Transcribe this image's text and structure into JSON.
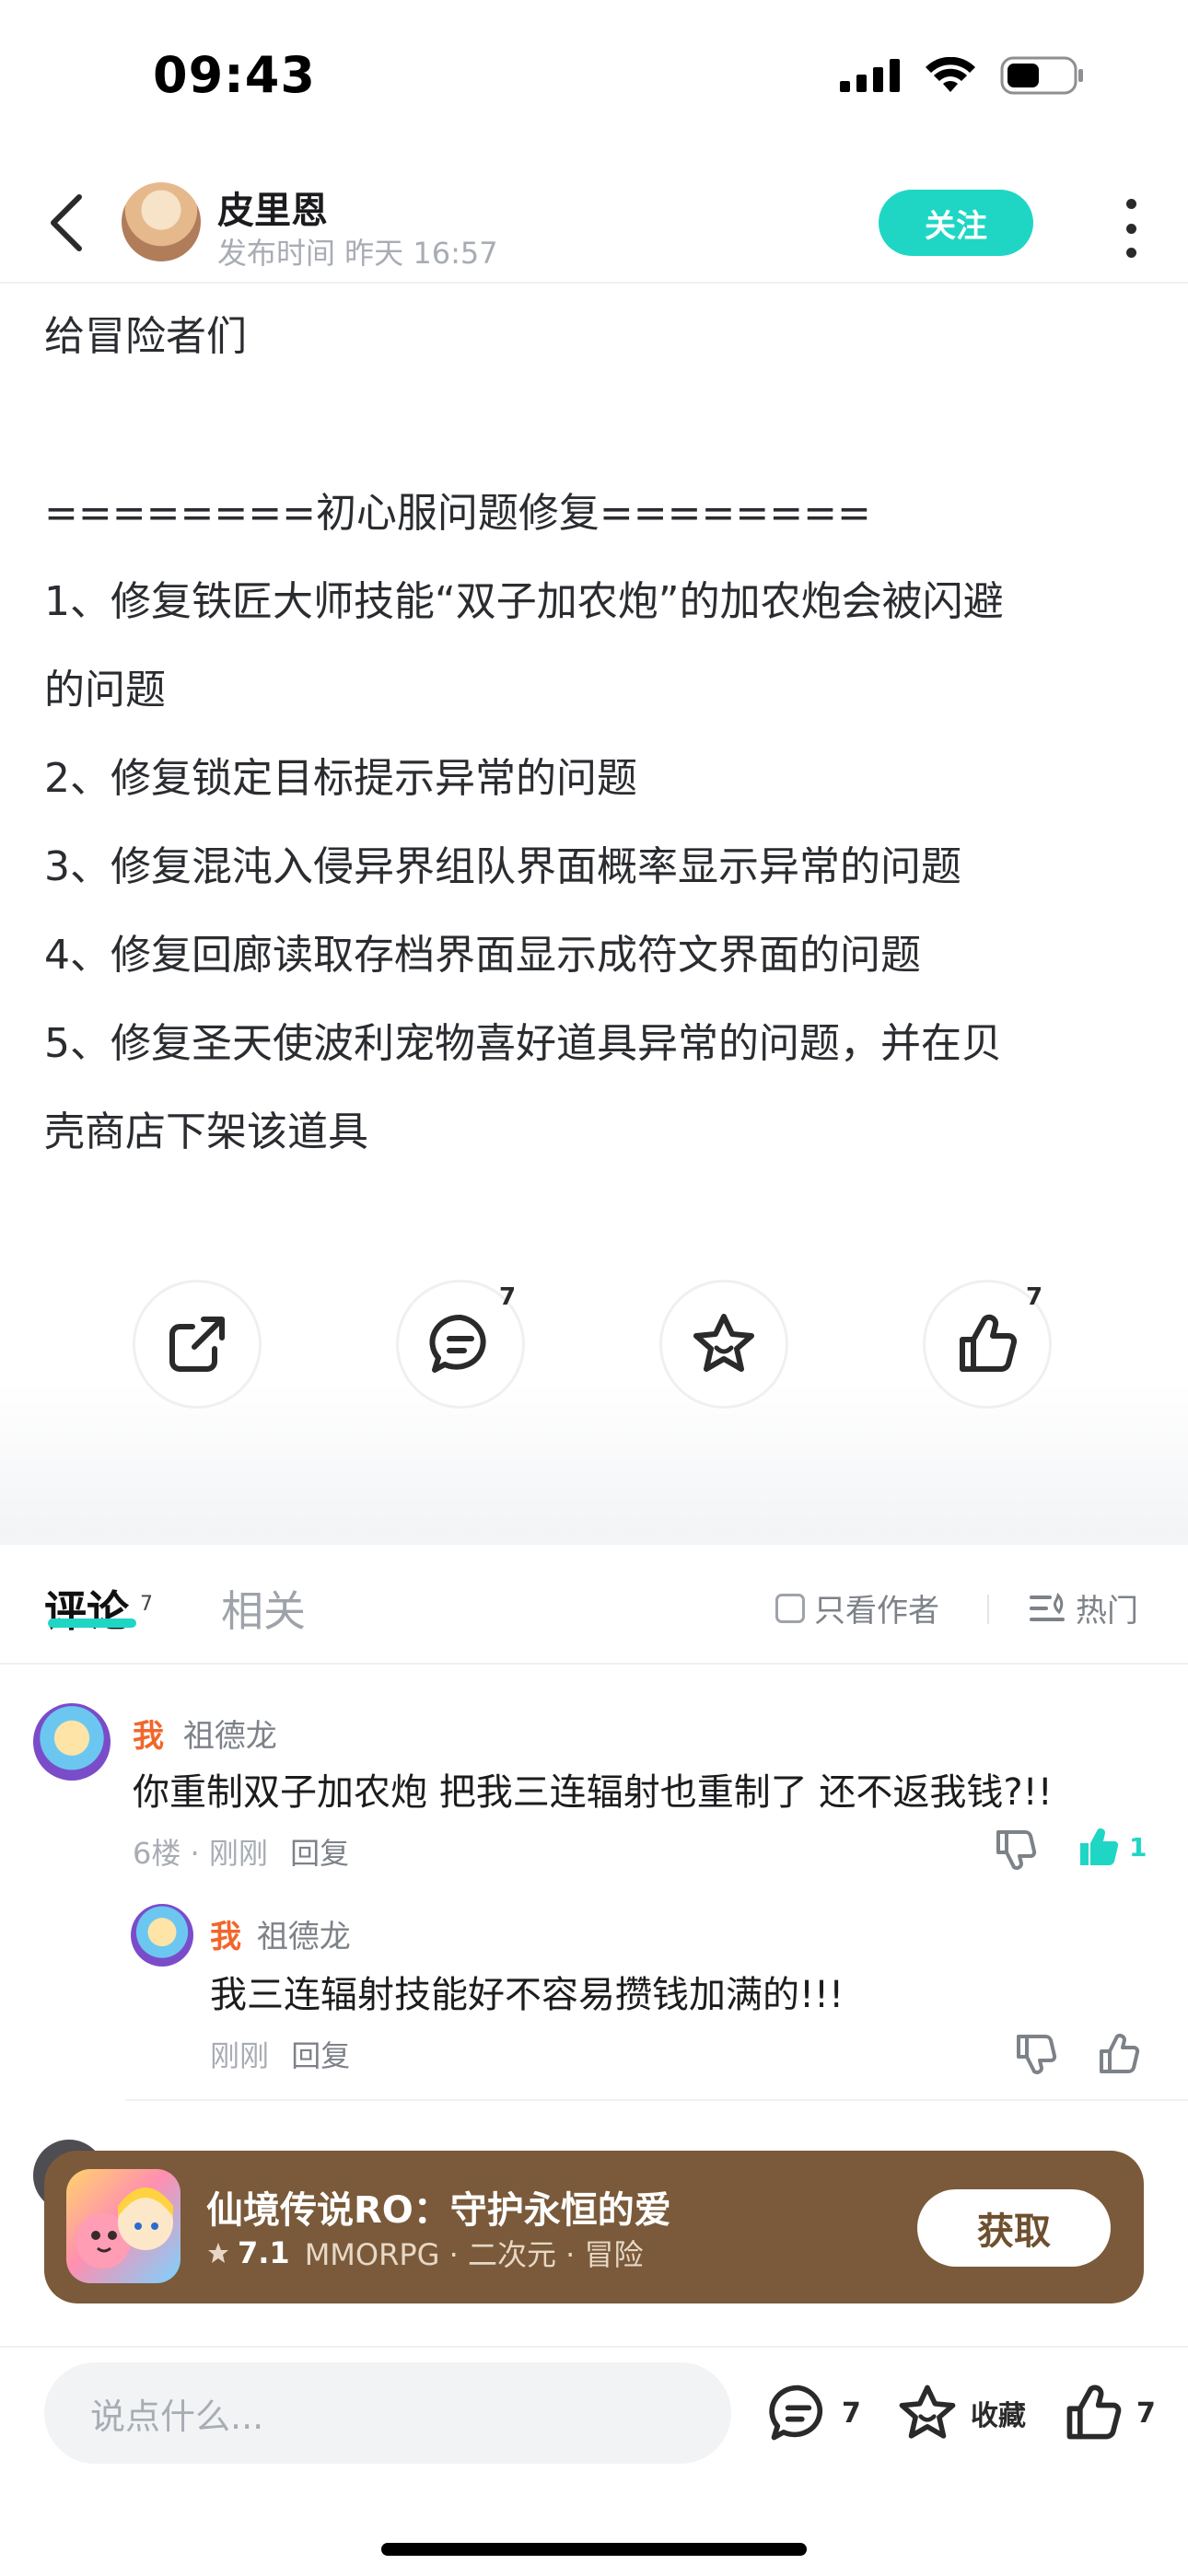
{
  "status_bar": {
    "time": "09:43"
  },
  "header": {
    "author_name": "皮里恩",
    "post_time": "发布时间 昨天 16:57",
    "follow_label": "关注"
  },
  "post": {
    "lines": [
      "给冒险者们",
      "",
      "========初心服问题修复========",
      "1、修复铁匠大师技能“双子加农炮”的加农炮会被闪避",
      "的问题",
      "2、修复锁定目标提示异常的问题",
      "3、修复混沌入侵异界组队界面概率显示异常的问题",
      "4、修复回廊读取存档界面显示成符文界面的问题",
      "5、修复圣天使波利宠物喜好道具异常的问题，并在贝",
      "壳商店下架该道具"
    ]
  },
  "actions": {
    "comment_count": "7",
    "like_count": "7"
  },
  "tabs": {
    "comments_label": "评论",
    "comments_count": "7",
    "related_label": "相关",
    "only_author_label": "只看作者",
    "hot_label": "热门"
  },
  "comment": {
    "me_tag": "我",
    "username": "祖德龙",
    "text": "你重制双子加农炮 把我三连辐射也重制了 还不返我钱?!!",
    "floor_time": "6楼 · 刚刚",
    "reply_label": "回复",
    "like_count": "1",
    "reply": {
      "me_tag": "我",
      "username": "祖德龙",
      "text": "我三连辐射技能好不容易攒钱加满的!!!",
      "time": "刚刚",
      "reply_label": "回复"
    }
  },
  "game_banner": {
    "title": "仙境传说RO：守护永恒的爱",
    "score": "7.1",
    "tags": "MMORPG · 二次元 · 冒险",
    "get_label": "获取"
  },
  "bottom_bar": {
    "input_placeholder": "说点什么...",
    "comment_count": "7",
    "favorite_label": "收藏",
    "like_count": "7"
  }
}
